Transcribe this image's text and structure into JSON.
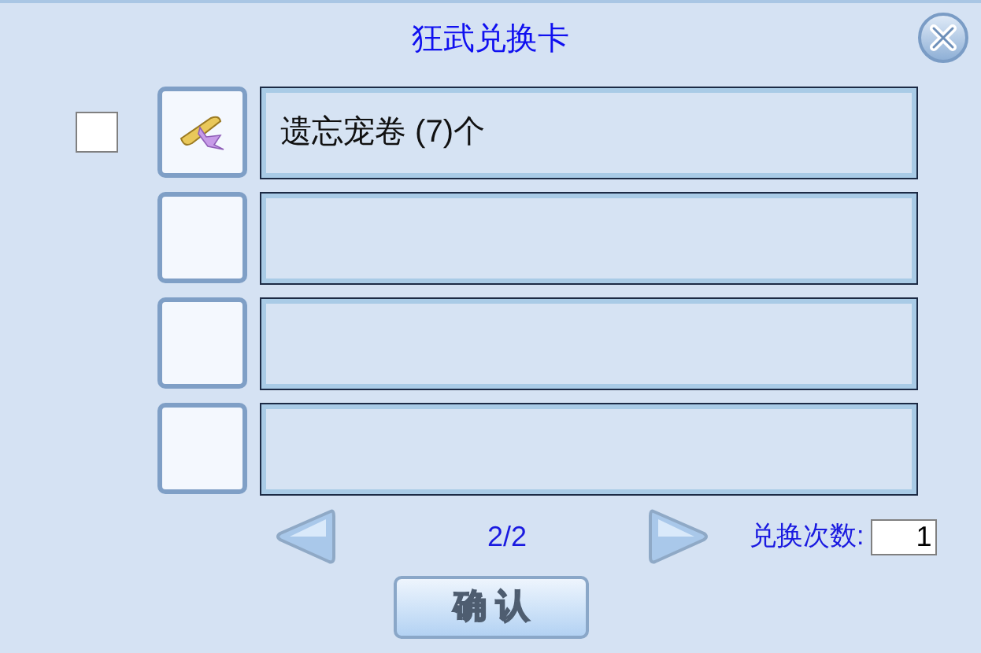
{
  "window": {
    "title": "狂武兑换卡"
  },
  "slots": [
    {
      "kind": "filled",
      "checked": false,
      "label": "遗忘宠卷 (7)个"
    },
    {
      "kind": "empty"
    },
    {
      "kind": "empty"
    },
    {
      "kind": "empty"
    }
  ],
  "pager": {
    "page": "2/2"
  },
  "exchange_count": {
    "label": "兑换次数:",
    "value": "1"
  },
  "buttons": [
    "确 认"
  ]
}
